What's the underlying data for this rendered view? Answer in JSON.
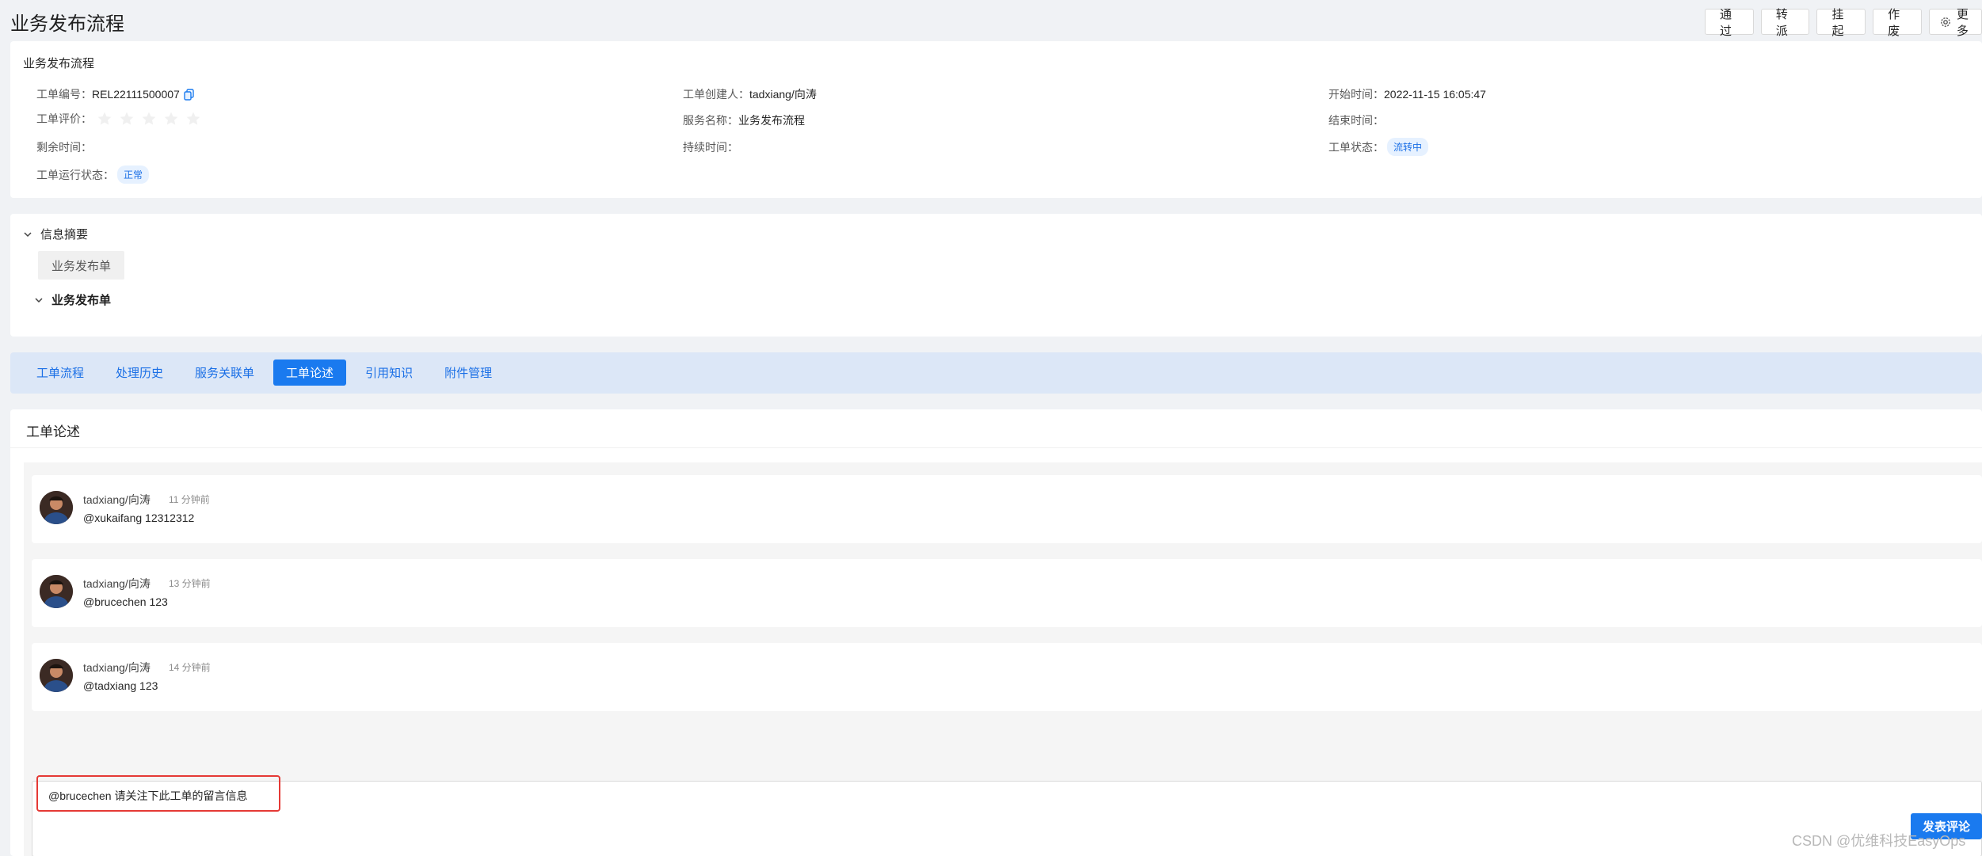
{
  "header": {
    "title": "业务发布流程",
    "actions": {
      "approve": "通过",
      "transfer": "转派",
      "suspend": "挂起",
      "void": "作废",
      "more": "更多"
    }
  },
  "info": {
    "section_title": "业务发布流程",
    "ticket_no_label": "工单编号：",
    "ticket_no": "REL22111500007",
    "rating_label": "工单评价：",
    "rating": 0,
    "remaining_label": "剩余时间：",
    "remaining": "",
    "run_status_label": "工单运行状态：",
    "run_status": "正常",
    "creator_label": "工单创建人：",
    "creator": "tadxiang/向涛",
    "service_label": "服务名称：",
    "service": "业务发布流程",
    "duration_label": "持续时间：",
    "duration": "",
    "start_label": "开始时间：",
    "start": "2022-11-15 16:05:47",
    "end_label": "结束时间：",
    "end": "",
    "status_label": "工单状态：",
    "status": "流转中"
  },
  "summary": {
    "toggle_label": "信息摘要",
    "chip": "业务发布单",
    "form_label": "业务发布单"
  },
  "tabs": [
    {
      "label": "工单流程",
      "active": false
    },
    {
      "label": "处理历史",
      "active": false
    },
    {
      "label": "服务关联单",
      "active": false
    },
    {
      "label": "工单论述",
      "active": true
    },
    {
      "label": "引用知识",
      "active": false
    },
    {
      "label": "附件管理",
      "active": false
    }
  ],
  "comments": {
    "title": "工单论述",
    "items": [
      {
        "author": "tadxiang/向涛",
        "time": "11 分钟前",
        "text": "@xukaifang 12312312"
      },
      {
        "author": "tadxiang/向涛",
        "time": "13 分钟前",
        "text": "@brucechen 123"
      },
      {
        "author": "tadxiang/向涛",
        "time": "14 分钟前",
        "text": "@tadxiang 123"
      }
    ],
    "reply_value": "@brucechen 请关注下此工单的留言信息",
    "submit_label": "发表评论"
  },
  "watermark": "CSDN @优维科技EasyOps",
  "colors": {
    "primary": "#1a7aef",
    "highlight": "#e53935",
    "tab_bar": "#dce7f7"
  }
}
